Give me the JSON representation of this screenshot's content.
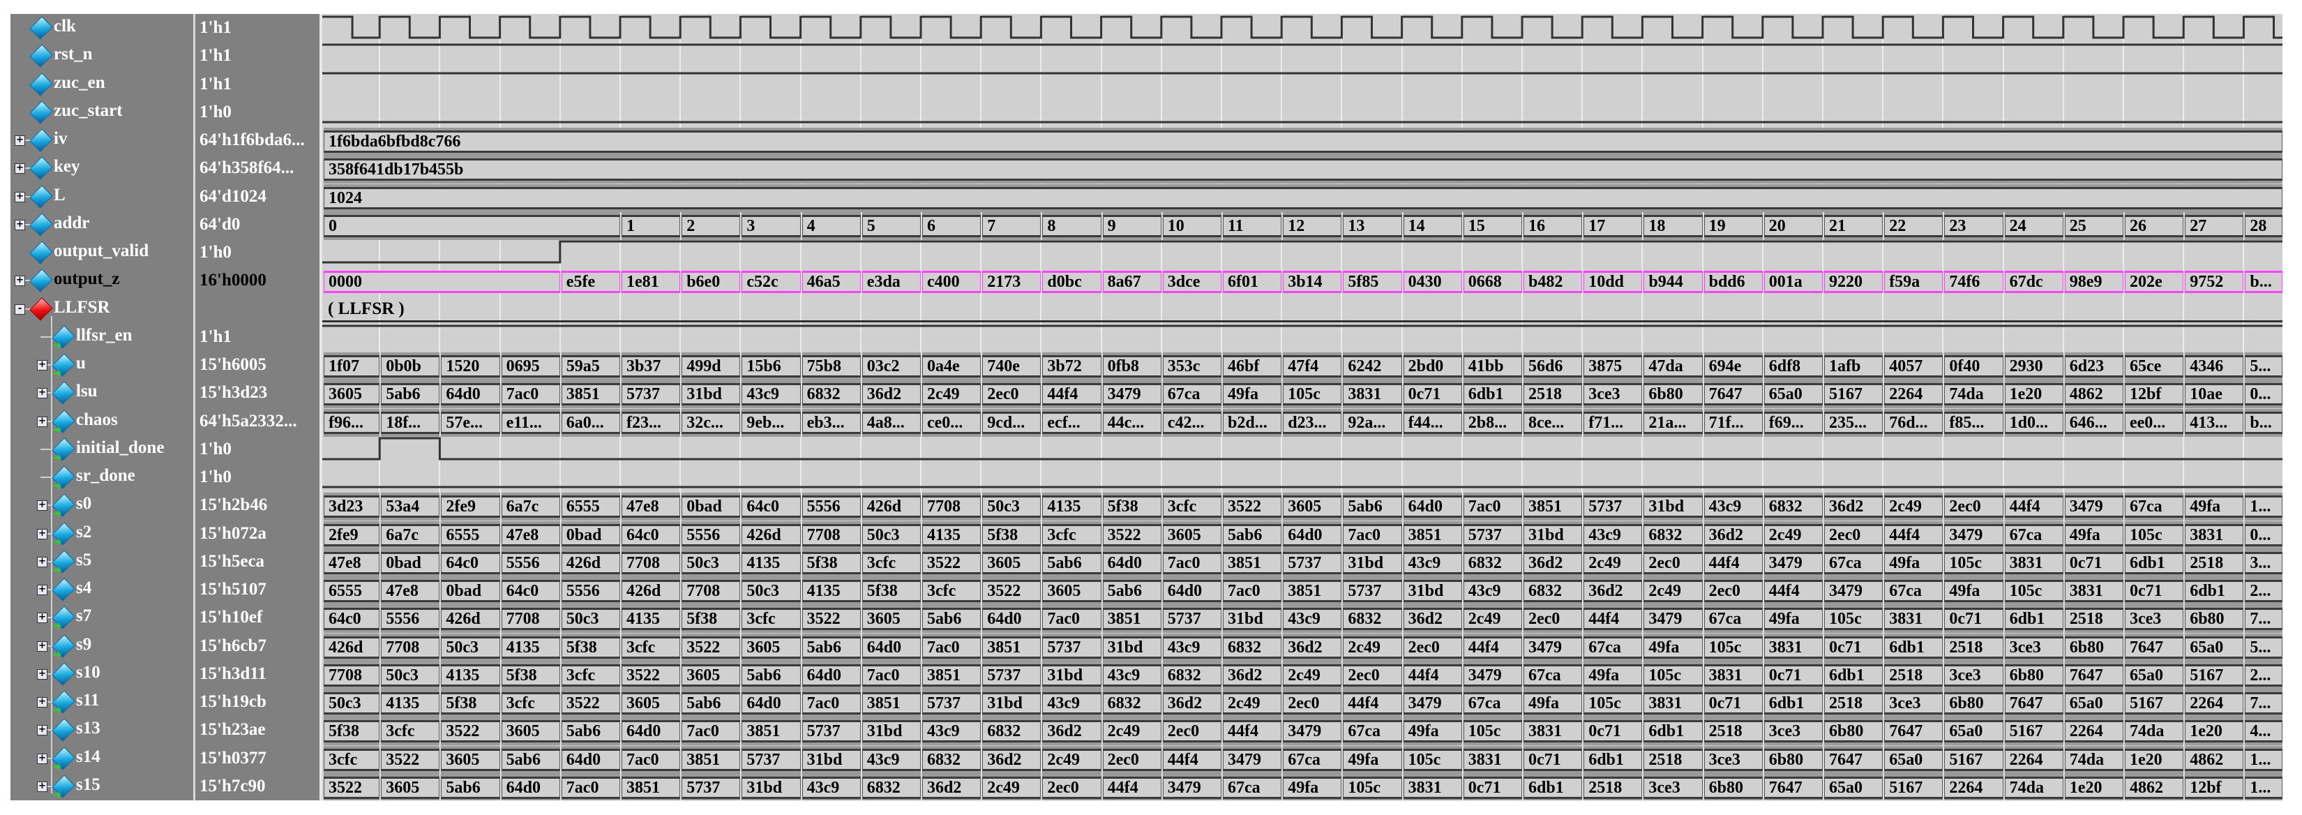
{
  "signals": [
    {
      "name": "clk",
      "value": "1'h1",
      "kind": "clock",
      "icon": "blue"
    },
    {
      "name": "rst_n",
      "value": "1'h1",
      "kind": "bit",
      "icon": "blue",
      "levels": [
        1
      ],
      "spans": [
        33
      ]
    },
    {
      "name": "zuc_en",
      "value": "1'h1",
      "kind": "bit",
      "icon": "blue",
      "levels": [
        1
      ],
      "spans": [
        33
      ]
    },
    {
      "name": "zuc_start",
      "value": "1'h0",
      "kind": "bit",
      "icon": "blue",
      "levels": [
        0
      ],
      "spans": [
        33
      ]
    },
    {
      "name": "iv",
      "value": "64'h1f6bda6...",
      "kind": "bus",
      "icon": "blue",
      "expand": "+",
      "values": [
        "1f6bda6bfbd8c766"
      ],
      "spans": [
        33
      ]
    },
    {
      "name": "key",
      "value": "64'h358f64...",
      "kind": "bus",
      "icon": "blue",
      "expand": "+",
      "values": [
        "358f641db17b455b"
      ],
      "spans": [
        33
      ]
    },
    {
      "name": "L",
      "value": "64'd1024",
      "kind": "bus",
      "icon": "blue",
      "expand": "+",
      "values": [
        "1024"
      ],
      "spans": [
        33
      ]
    },
    {
      "name": "addr",
      "value": "64'd0",
      "kind": "bus",
      "icon": "blue",
      "expand": "+",
      "values": [
        "0",
        "1",
        "2",
        "3",
        "4",
        "5",
        "6",
        "7",
        "8",
        "9",
        "10",
        "11",
        "12",
        "13",
        "14",
        "15",
        "16",
        "17",
        "18",
        "19",
        "20",
        "21",
        "22",
        "23",
        "24",
        "25",
        "26",
        "27",
        "28"
      ],
      "spans": [
        5
      ]
    },
    {
      "name": "output_valid",
      "value": "1'h0",
      "kind": "bit",
      "icon": "blue",
      "levels": [
        0,
        1
      ],
      "spans": [
        4,
        29
      ]
    },
    {
      "name": "output_z",
      "value": "16'h0000",
      "kind": "bus",
      "icon": "blue",
      "expand": "+",
      "selected": true,
      "color": "#ff40ff",
      "values": [
        "0000",
        "e5fe",
        "1e81",
        "b6e0",
        "c52c",
        "46a5",
        "e3da",
        "c400",
        "2173",
        "d0bc",
        "8a67",
        "3dce",
        "6f01",
        "3b14",
        "5f85",
        "0430",
        "0668",
        "b482",
        "10dd",
        "b944",
        "bdd6",
        "001a",
        "9220",
        "f59a",
        "74f6",
        "67dc",
        "98e9",
        "202e",
        "9752",
        "b..."
      ],
      "spans": [
        4
      ]
    },
    {
      "name": "LLFSR",
      "value": "",
      "kind": "group",
      "icon": "red",
      "expand": "-",
      "label": "( LLFSR )"
    },
    {
      "name": "llfsr_en",
      "value": "1'h1",
      "kind": "bit",
      "icon": "blue",
      "child": true,
      "port": true,
      "levels": [
        1
      ],
      "spans": [
        33
      ]
    },
    {
      "name": "u",
      "value": "15'h6005",
      "kind": "bus",
      "icon": "blue",
      "child": true,
      "port": true,
      "expand": "+",
      "values": [
        "1f07",
        "0b0b",
        "1520",
        "0695",
        "59a5",
        "3b37",
        "499d",
        "15b6",
        "75b8",
        "03c2",
        "0a4e",
        "740e",
        "3b72",
        "0fb8",
        "353c",
        "46bf",
        "47f4",
        "6242",
        "2bd0",
        "41bb",
        "56d6",
        "3875",
        "47da",
        "694e",
        "6df8",
        "1afb",
        "4057",
        "0f40",
        "2930",
        "6d23",
        "65ce",
        "4346",
        "5..."
      ]
    },
    {
      "name": "lsu",
      "value": "15'h3d23",
      "kind": "bus",
      "icon": "blue",
      "child": true,
      "expand": "+",
      "values": [
        "3605",
        "5ab6",
        "64d0",
        "7ac0",
        "3851",
        "5737",
        "31bd",
        "43c9",
        "6832",
        "36d2",
        "2c49",
        "2ec0",
        "44f4",
        "3479",
        "67ca",
        "49fa",
        "105c",
        "3831",
        "0c71",
        "6db1",
        "2518",
        "3ce3",
        "6b80",
        "7647",
        "65a0",
        "5167",
        "2264",
        "74da",
        "1e20",
        "4862",
        "12bf",
        "10ae",
        "0..."
      ]
    },
    {
      "name": "chaos",
      "value": "64'h5a2332...",
      "kind": "bus",
      "icon": "blue",
      "child": true,
      "port": true,
      "expand": "+",
      "values": [
        "f96...",
        "18f...",
        "57e...",
        "e11...",
        "6a0...",
        "f23...",
        "32c...",
        "9eb...",
        "eb3...",
        "4a8...",
        "ce0...",
        "9cd...",
        "ecf...",
        "44c...",
        "c42...",
        "b2d...",
        "d23...",
        "92a...",
        "f44...",
        "2b8...",
        "8ce...",
        "f71...",
        "21a...",
        "71f...",
        "f69...",
        "235...",
        "76d...",
        "f85...",
        "1d0...",
        "646...",
        "ee0...",
        "413...",
        "b..."
      ]
    },
    {
      "name": "initial_done",
      "value": "1'h0",
      "kind": "bit",
      "icon": "blue",
      "child": true,
      "port": true,
      "levels": [
        0,
        1,
        0
      ],
      "spans": [
        1,
        1,
        31
      ]
    },
    {
      "name": "sr_done",
      "value": "1'h0",
      "kind": "bit",
      "icon": "blue",
      "child": true,
      "port": true,
      "levels": [
        0
      ],
      "spans": [
        33
      ]
    },
    {
      "name": "s0",
      "value": "15'h2b46",
      "kind": "bus",
      "icon": "blue",
      "child": true,
      "port": true,
      "expand": "+",
      "values": [
        "3d23",
        "53a4",
        "2fe9",
        "6a7c",
        "6555",
        "47e8",
        "0bad",
        "64c0",
        "5556",
        "426d",
        "7708",
        "50c3",
        "4135",
        "5f38",
        "3cfc",
        "3522",
        "3605",
        "5ab6",
        "64d0",
        "7ac0",
        "3851",
        "5737",
        "31bd",
        "43c9",
        "6832",
        "36d2",
        "2c49",
        "2ec0",
        "44f4",
        "3479",
        "67ca",
        "49fa",
        "1..."
      ]
    },
    {
      "name": "s2",
      "value": "15'h072a",
      "kind": "bus",
      "icon": "blue",
      "child": true,
      "port": true,
      "expand": "+",
      "values": [
        "2fe9",
        "6a7c",
        "6555",
        "47e8",
        "0bad",
        "64c0",
        "5556",
        "426d",
        "7708",
        "50c3",
        "4135",
        "5f38",
        "3cfc",
        "3522",
        "3605",
        "5ab6",
        "64d0",
        "7ac0",
        "3851",
        "5737",
        "31bd",
        "43c9",
        "6832",
        "36d2",
        "2c49",
        "2ec0",
        "44f4",
        "3479",
        "67ca",
        "49fa",
        "105c",
        "3831",
        "0..."
      ]
    },
    {
      "name": "s5",
      "value": "15'h5eca",
      "kind": "bus",
      "icon": "blue",
      "child": true,
      "port": true,
      "expand": "+",
      "values": [
        "47e8",
        "0bad",
        "64c0",
        "5556",
        "426d",
        "7708",
        "50c3",
        "4135",
        "5f38",
        "3cfc",
        "3522",
        "3605",
        "5ab6",
        "64d0",
        "7ac0",
        "3851",
        "5737",
        "31bd",
        "43c9",
        "6832",
        "36d2",
        "2c49",
        "2ec0",
        "44f4",
        "3479",
        "67ca",
        "49fa",
        "105c",
        "3831",
        "0c71",
        "6db1",
        "2518",
        "3..."
      ]
    },
    {
      "name": "s4",
      "value": "15'h5107",
      "kind": "bus",
      "icon": "blue",
      "child": true,
      "expand": "+",
      "values": [
        "6555",
        "47e8",
        "0bad",
        "64c0",
        "5556",
        "426d",
        "7708",
        "50c3",
        "4135",
        "5f38",
        "3cfc",
        "3522",
        "3605",
        "5ab6",
        "64d0",
        "7ac0",
        "3851",
        "5737",
        "31bd",
        "43c9",
        "6832",
        "36d2",
        "2c49",
        "2ec0",
        "44f4",
        "3479",
        "67ca",
        "49fa",
        "105c",
        "3831",
        "0c71",
        "6db1",
        "2..."
      ]
    },
    {
      "name": "s7",
      "value": "15'h10ef",
      "kind": "bus",
      "icon": "blue",
      "child": true,
      "port": true,
      "expand": "+",
      "values": [
        "64c0",
        "5556",
        "426d",
        "7708",
        "50c3",
        "4135",
        "5f38",
        "3cfc",
        "3522",
        "3605",
        "5ab6",
        "64d0",
        "7ac0",
        "3851",
        "5737",
        "31bd",
        "43c9",
        "6832",
        "36d2",
        "2c49",
        "2ec0",
        "44f4",
        "3479",
        "67ca",
        "49fa",
        "105c",
        "3831",
        "0c71",
        "6db1",
        "2518",
        "3ce3",
        "6b80",
        "7..."
      ]
    },
    {
      "name": "s9",
      "value": "15'h6cb7",
      "kind": "bus",
      "icon": "blue",
      "child": true,
      "port": true,
      "expand": "+",
      "values": [
        "426d",
        "7708",
        "50c3",
        "4135",
        "5f38",
        "3cfc",
        "3522",
        "3605",
        "5ab6",
        "64d0",
        "7ac0",
        "3851",
        "5737",
        "31bd",
        "43c9",
        "6832",
        "36d2",
        "2c49",
        "2ec0",
        "44f4",
        "3479",
        "67ca",
        "49fa",
        "105c",
        "3831",
        "0c71",
        "6db1",
        "2518",
        "3ce3",
        "6b80",
        "7647",
        "65a0",
        "5..."
      ]
    },
    {
      "name": "s10",
      "value": "15'h3d11",
      "kind": "bus",
      "icon": "blue",
      "child": true,
      "expand": "+",
      "values": [
        "7708",
        "50c3",
        "4135",
        "5f38",
        "3cfc",
        "3522",
        "3605",
        "5ab6",
        "64d0",
        "7ac0",
        "3851",
        "5737",
        "31bd",
        "43c9",
        "6832",
        "36d2",
        "2c49",
        "2ec0",
        "44f4",
        "3479",
        "67ca",
        "49fa",
        "105c",
        "3831",
        "0c71",
        "6db1",
        "2518",
        "3ce3",
        "6b80",
        "7647",
        "65a0",
        "5167",
        "2..."
      ]
    },
    {
      "name": "s11",
      "value": "15'h19cb",
      "kind": "bus",
      "icon": "blue",
      "child": true,
      "port": true,
      "expand": "+",
      "values": [
        "50c3",
        "4135",
        "5f38",
        "3cfc",
        "3522",
        "3605",
        "5ab6",
        "64d0",
        "7ac0",
        "3851",
        "5737",
        "31bd",
        "43c9",
        "6832",
        "36d2",
        "2c49",
        "2ec0",
        "44f4",
        "3479",
        "67ca",
        "49fa",
        "105c",
        "3831",
        "0c71",
        "6db1",
        "2518",
        "3ce3",
        "6b80",
        "7647",
        "65a0",
        "5167",
        "2264",
        "7..."
      ]
    },
    {
      "name": "s13",
      "value": "15'h23ae",
      "kind": "bus",
      "icon": "blue",
      "child": true,
      "expand": "+",
      "values": [
        "5f38",
        "3cfc",
        "3522",
        "3605",
        "5ab6",
        "64d0",
        "7ac0",
        "3851",
        "5737",
        "31bd",
        "43c9",
        "6832",
        "36d2",
        "2c49",
        "2ec0",
        "44f4",
        "3479",
        "67ca",
        "49fa",
        "105c",
        "3831",
        "0c71",
        "6db1",
        "2518",
        "3ce3",
        "6b80",
        "7647",
        "65a0",
        "5167",
        "2264",
        "74da",
        "1e20",
        "4..."
      ]
    },
    {
      "name": "s14",
      "value": "15'h0377",
      "kind": "bus",
      "icon": "blue",
      "child": true,
      "port": true,
      "expand": "+",
      "values": [
        "3cfc",
        "3522",
        "3605",
        "5ab6",
        "64d0",
        "7ac0",
        "3851",
        "5737",
        "31bd",
        "43c9",
        "6832",
        "36d2",
        "2c49",
        "2ec0",
        "44f4",
        "3479",
        "67ca",
        "49fa",
        "105c",
        "3831",
        "0c71",
        "6db1",
        "2518",
        "3ce3",
        "6b80",
        "7647",
        "65a0",
        "5167",
        "2264",
        "74da",
        "1e20",
        "4862",
        "1..."
      ]
    },
    {
      "name": "s15",
      "value": "15'h7c90",
      "kind": "bus",
      "icon": "blue",
      "child": true,
      "port": true,
      "expand": "+",
      "values": [
        "3522",
        "3605",
        "5ab6",
        "64d0",
        "7ac0",
        "3851",
        "5737",
        "31bd",
        "43c9",
        "6832",
        "36d2",
        "2c49",
        "2ec0",
        "44f4",
        "3479",
        "67ca",
        "49fa",
        "105c",
        "3831",
        "0c71",
        "6db1",
        "2518",
        "3ce3",
        "6b80",
        "7647",
        "65a0",
        "5167",
        "2264",
        "74da",
        "1e20",
        "4862",
        "12bf",
        "1..."
      ]
    }
  ],
  "total_cycles": 33
}
